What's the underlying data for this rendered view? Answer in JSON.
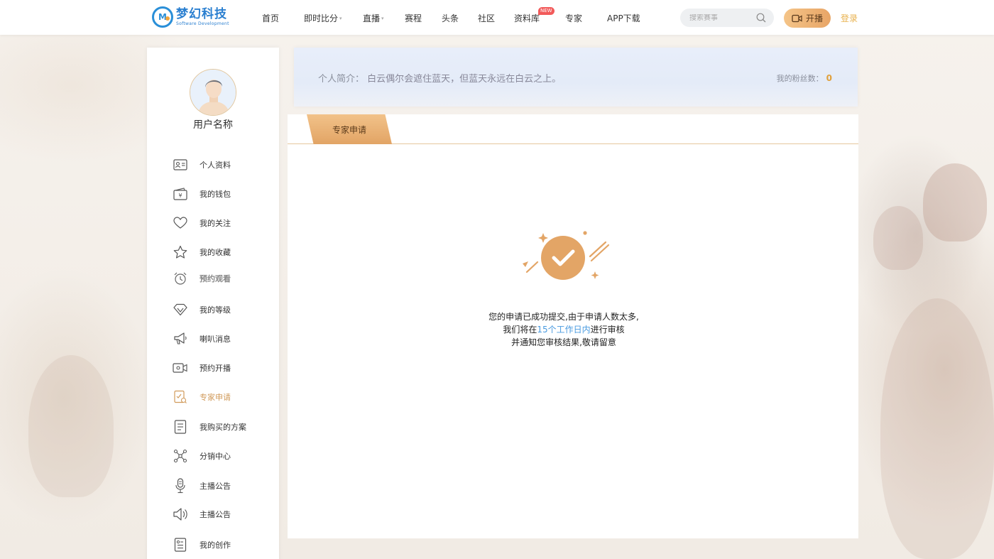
{
  "header": {
    "logo_cn": "梦幻科技",
    "logo_en": "Software Development",
    "nav": [
      {
        "label": "首页",
        "caret": false,
        "badge": ""
      },
      {
        "label": "即时比分",
        "caret": true,
        "badge": ""
      },
      {
        "label": "直播",
        "caret": true,
        "badge": ""
      },
      {
        "label": "赛程",
        "caret": false,
        "badge": ""
      },
      {
        "label": "头条",
        "caret": false,
        "badge": ""
      },
      {
        "label": "社区",
        "caret": false,
        "badge": ""
      },
      {
        "label": "资料库",
        "caret": false,
        "badge": "NEW"
      },
      {
        "label": "专家",
        "caret": false,
        "badge": ""
      },
      {
        "label": "APP下载",
        "caret": false,
        "badge": ""
      }
    ],
    "search_placeholder": "搜索赛事",
    "live_button": "开播",
    "login": "登录"
  },
  "sidebar": {
    "username": "用户名称",
    "items": [
      {
        "label": "个人资料",
        "icon": "id-card-icon"
      },
      {
        "label": "我的钱包",
        "icon": "wallet-icon"
      },
      {
        "label": "我的关注",
        "icon": "heart-icon"
      },
      {
        "label": "我的收藏",
        "icon": "star-icon"
      },
      {
        "label": "预约观看",
        "icon": "alarm-clock-icon"
      },
      {
        "label": "我的等级",
        "icon": "diamond-icon"
      },
      {
        "label": "喇叭消息",
        "icon": "megaphone-icon"
      },
      {
        "label": "预约开播",
        "icon": "video-camera-icon"
      },
      {
        "label": "专家申请",
        "icon": "expert-apply-icon"
      },
      {
        "label": "我购买的方案",
        "icon": "document-icon"
      },
      {
        "label": "分销中心",
        "icon": "network-icon"
      },
      {
        "label": "主播公告",
        "icon": "microphone-icon"
      },
      {
        "label": "主播公告",
        "icon": "loudspeaker-icon"
      },
      {
        "label": "我的创作",
        "icon": "creation-icon"
      }
    ],
    "active_index": 8
  },
  "intro": {
    "label": "个人简介：",
    "text": "白云偶尔会遮住蓝天，但蓝天永远在白云之上。",
    "fans_label": "我的粉丝数：",
    "fans_count": "0"
  },
  "panel": {
    "tab": "专家申请",
    "message_line1": "您的申请已成功提交,由于申请人数太多,",
    "message_line2_pre": "我们将在",
    "message_line2_highlight": "15个工作日内",
    "message_line2_post": "进行审核",
    "message_line3": "并通知您审核结果,敬请留意"
  },
  "colors": {
    "accent": "#e2a465",
    "highlight": "#4a9be0",
    "brand": "#2a7fd0"
  }
}
